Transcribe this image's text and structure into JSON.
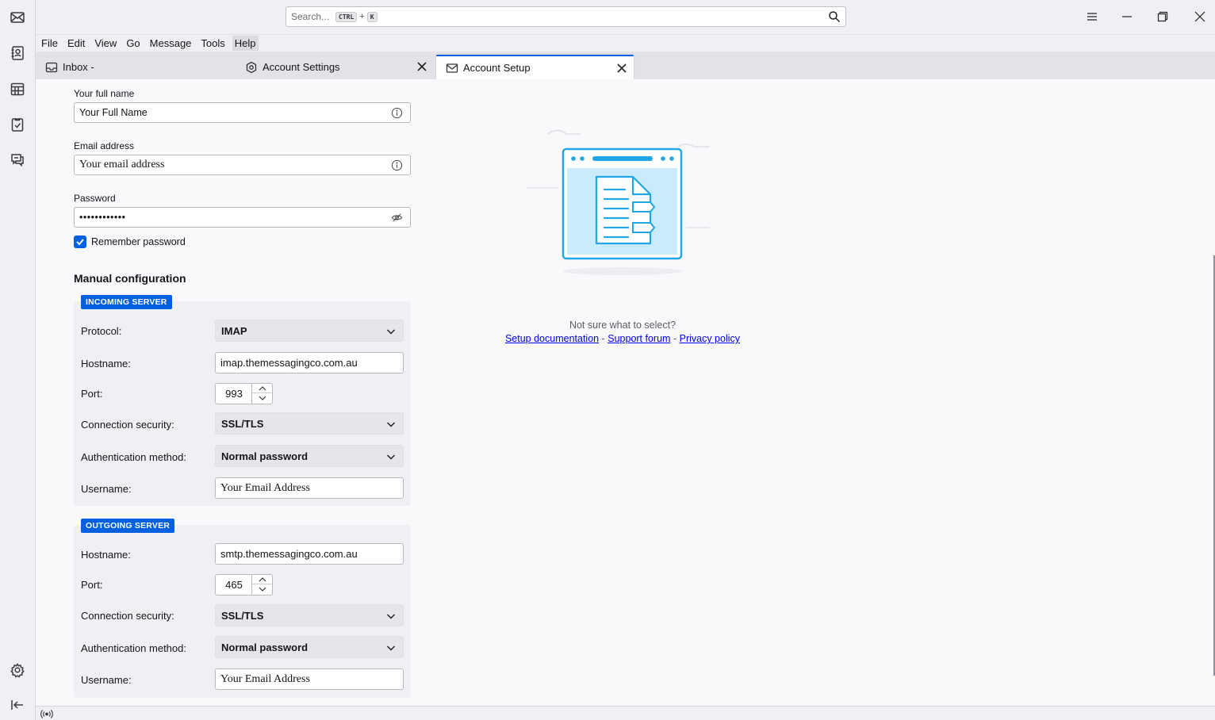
{
  "titlebar": {
    "search_placeholder": "Search...",
    "shortcut_key1": "CTRL",
    "shortcut_plus": "+",
    "shortcut_key2": "K"
  },
  "menubar": {
    "items": [
      "File",
      "Edit",
      "View",
      "Go",
      "Message",
      "Tools",
      "Help"
    ],
    "active": "Help"
  },
  "tabs": [
    {
      "label": "Inbox -",
      "icon": "inbox-icon"
    },
    {
      "label": "Account Settings",
      "icon": "settings-icon"
    },
    {
      "label": "Account Setup",
      "icon": "account-setup-icon",
      "selected": true
    }
  ],
  "form": {
    "full_name_label": "Your full name",
    "full_name_value": "Your Full Name",
    "email_label": "Email address",
    "email_value": "Your email address",
    "password_label": "Password",
    "password_value": "••••••••••••",
    "remember_label": "Remember password",
    "remember_checked": true
  },
  "manual": {
    "title": "Manual configuration",
    "incoming": {
      "badge": "INCOMING SERVER",
      "protocol_label": "Protocol:",
      "protocol_value": "IMAP",
      "hostname_label": "Hostname:",
      "hostname_value": "imap.themessagingco.com.au",
      "port_label": "Port:",
      "port_value": "993",
      "security_label": "Connection security:",
      "security_value": "SSL/TLS",
      "auth_label": "Authentication method:",
      "auth_value": "Normal password",
      "username_label": "Username:",
      "username_value": "Your Email Address"
    },
    "outgoing": {
      "badge": "OUTGOING SERVER",
      "hostname_label": "Hostname:",
      "hostname_value": "smtp.themessagingco.com.au",
      "port_label": "Port:",
      "port_value": "465",
      "security_label": "Connection security:",
      "security_value": "SSL/TLS",
      "auth_label": "Authentication method:",
      "auth_value": "Normal password",
      "username_label": "Username:",
      "username_value": "Your Email Address"
    }
  },
  "help": {
    "question": "Not sure what to select?",
    "link_docs": "Setup documentation",
    "sep1": "-",
    "link_forum": "Support forum",
    "sep2": "-",
    "link_privacy": "Privacy policy"
  },
  "colors": {
    "accent": "#0061e0",
    "illustration": "#21a6e8"
  }
}
